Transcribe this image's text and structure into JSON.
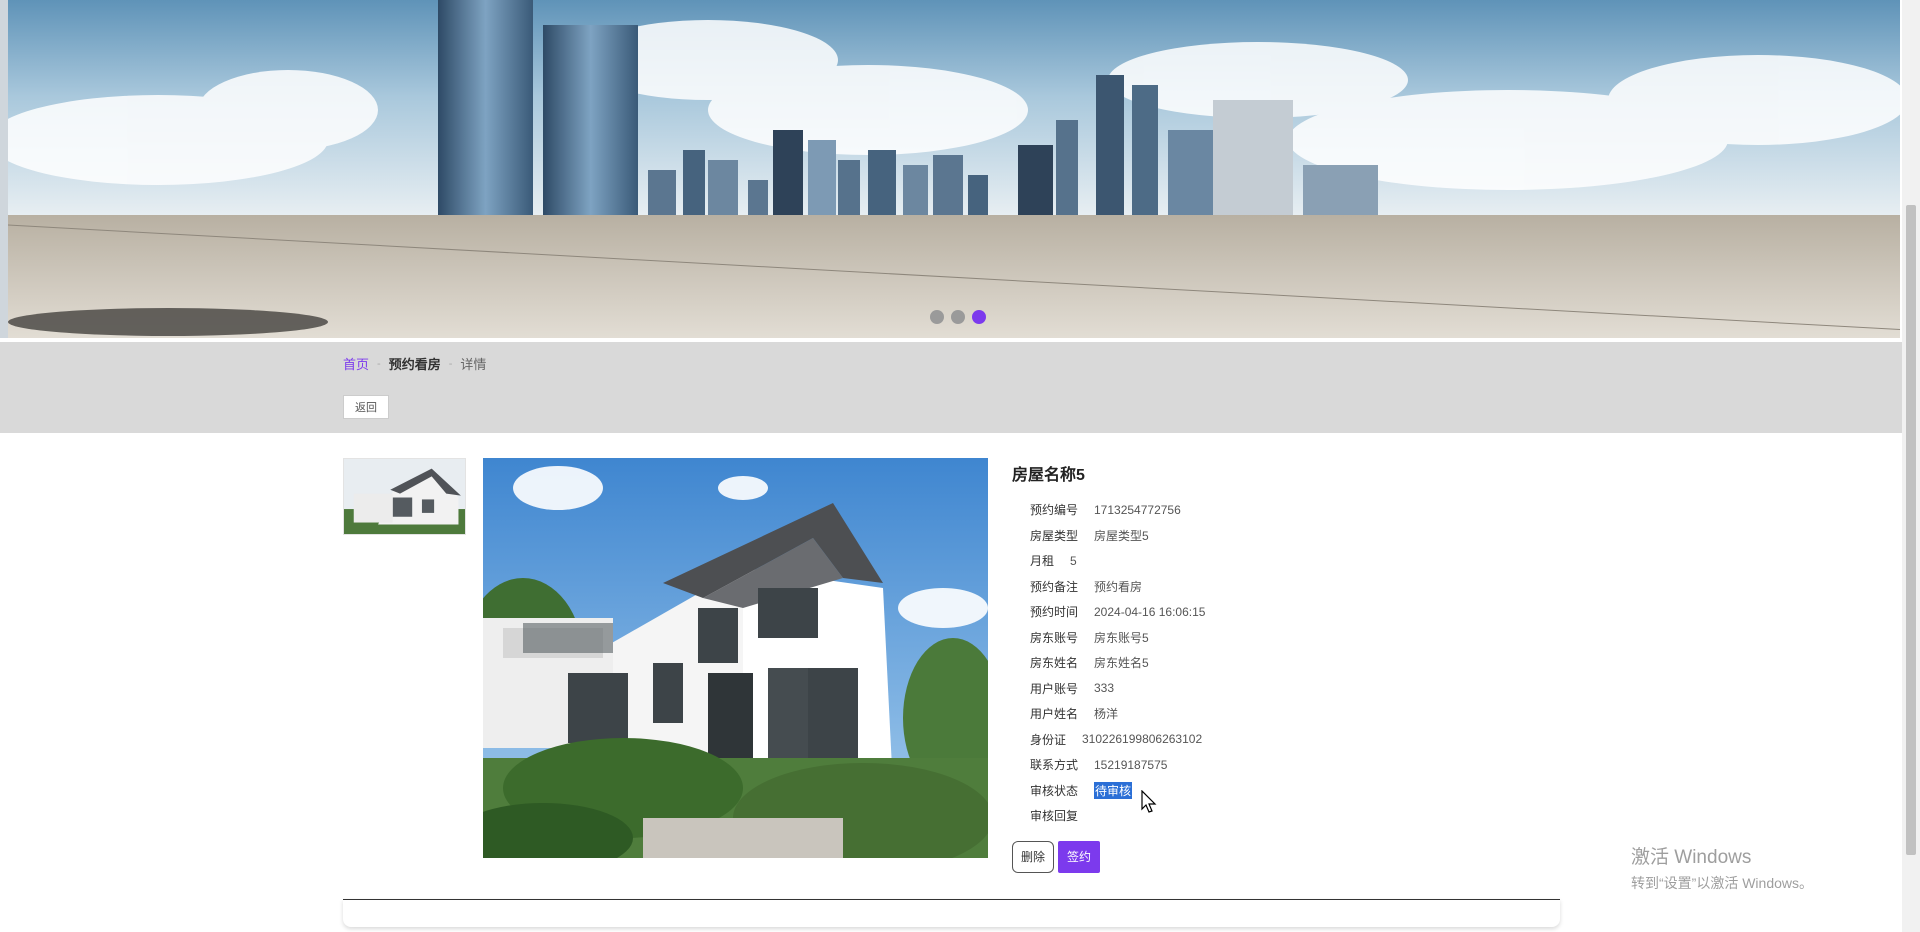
{
  "banner": {
    "slides": 3,
    "active_slide": 3
  },
  "breadcrumb": {
    "home": "首页",
    "section": "预约看房",
    "current": "详情",
    "separator": "-"
  },
  "back_label": "返回",
  "house": {
    "title": "房屋名称5",
    "fields": [
      {
        "label": "预约编号",
        "value": "1713254772756"
      },
      {
        "label": "房屋类型",
        "value": "房屋类型5"
      },
      {
        "label": "月租",
        "value": "5"
      },
      {
        "label": "预约备注",
        "value": "预约看房"
      },
      {
        "label": "预约时间",
        "value": "2024-04-16 16:06:15"
      },
      {
        "label": "房东账号",
        "value": "房东账号5"
      },
      {
        "label": "房东姓名",
        "value": "房东姓名5"
      },
      {
        "label": "用户账号",
        "value": "333"
      },
      {
        "label": "用户姓名",
        "value": "杨洋"
      },
      {
        "label": "身份证",
        "value": "310226199806263102"
      },
      {
        "label": "联系方式",
        "value": "15219187575"
      },
      {
        "label": "审核状态",
        "value": "待审核"
      },
      {
        "label": "审核回复",
        "value": ""
      }
    ]
  },
  "actions": {
    "delete_label": "删除",
    "sign_label": "签约"
  },
  "watermark": {
    "line1": "激活 Windows",
    "line2": "转到“设置”以激活 Windows。"
  },
  "colors": {
    "accent": "#7c3aed",
    "band": "#d9d9d9",
    "selection": "#2b6fd6"
  }
}
